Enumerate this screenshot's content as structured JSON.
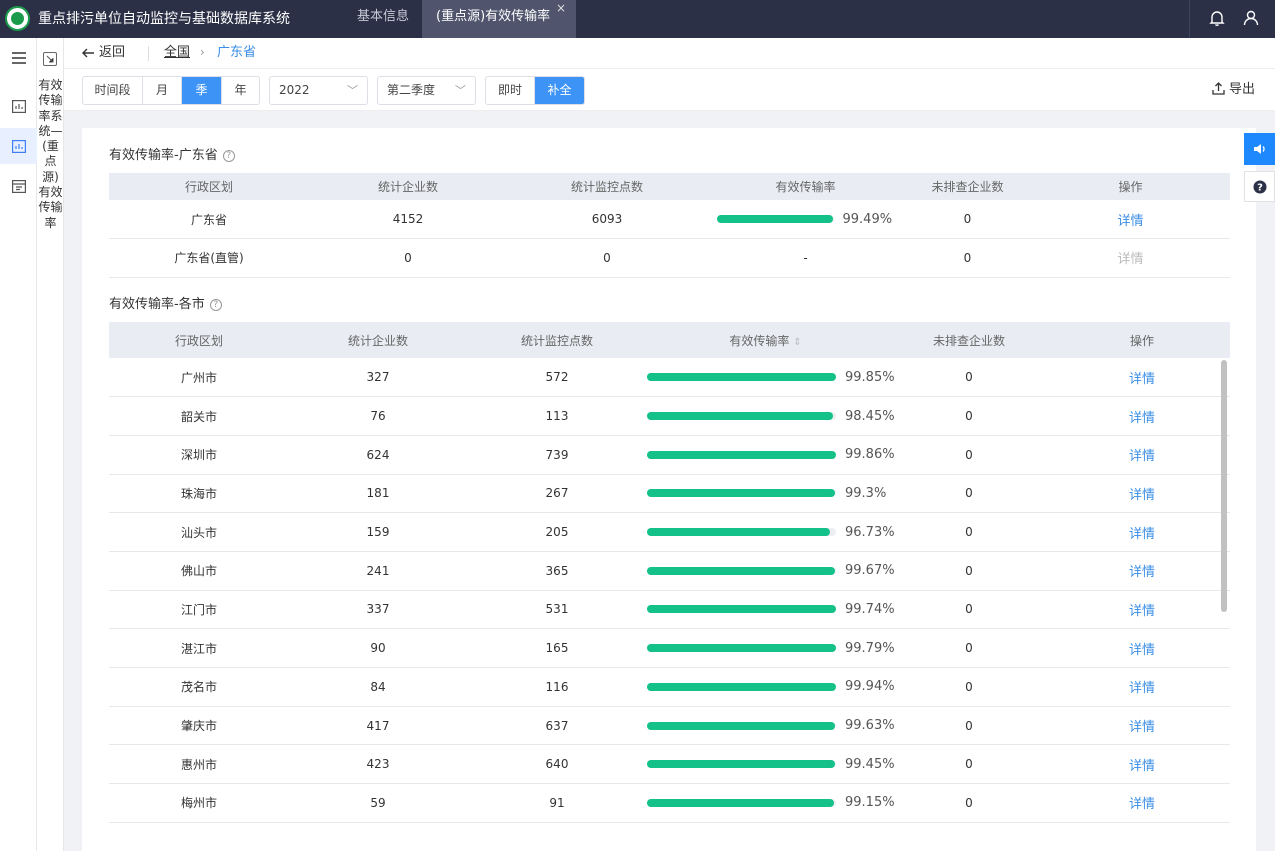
{
  "app": {
    "title": "重点排污单位自动监控与基础数据库系统"
  },
  "tabs": [
    {
      "label": "基本信息"
    },
    {
      "label": "(重点源)有效传输率",
      "close": "×"
    }
  ],
  "sidebar": {
    "vertical_label": "有效传输率系统—(重点源)有效传输率"
  },
  "breadcrumb": {
    "back": "返回",
    "root": "全国",
    "separator": "›",
    "current": "广东省"
  },
  "filters": {
    "period_buttons": [
      "时间段",
      "月",
      "季",
      "年"
    ],
    "period_selected": "季",
    "year": "2022",
    "quarter": "第二季度",
    "mode_buttons": [
      "即时",
      "补全"
    ],
    "mode_selected": "补全",
    "export": "导出"
  },
  "province_section": {
    "title": "有效传输率-广东省",
    "help": "?",
    "columns": [
      "行政区划",
      "统计企业数",
      "统计监控点数",
      "有效传输率",
      "未排查企业数",
      "操作"
    ],
    "rows": [
      {
        "region": "广东省",
        "enterprises": "4152",
        "points": "6093",
        "rate": 99.49,
        "rate_text": "99.49%",
        "unchecked": "0",
        "action": "详情",
        "enabled": true
      },
      {
        "region": "广东省(直管)",
        "enterprises": "0",
        "points": "0",
        "rate": null,
        "rate_text": "-",
        "unchecked": "0",
        "action": "详情",
        "enabled": false
      }
    ]
  },
  "city_section": {
    "title": "有效传输率-各市",
    "help": "?",
    "columns": [
      "行政区划",
      "统计企业数",
      "统计监控点数",
      "有效传输率",
      "未排查企业数",
      "操作"
    ],
    "sort_icon": "⇕",
    "rows": [
      {
        "region": "广州市",
        "enterprises": "327",
        "points": "572",
        "rate": 99.85,
        "rate_text": "99.85%",
        "unchecked": "0",
        "action": "详情"
      },
      {
        "region": "韶关市",
        "enterprises": "76",
        "points": "113",
        "rate": 98.45,
        "rate_text": "98.45%",
        "unchecked": "0",
        "action": "详情"
      },
      {
        "region": "深圳市",
        "enterprises": "624",
        "points": "739",
        "rate": 99.86,
        "rate_text": "99.86%",
        "unchecked": "0",
        "action": "详情"
      },
      {
        "region": "珠海市",
        "enterprises": "181",
        "points": "267",
        "rate": 99.3,
        "rate_text": "99.3%",
        "unchecked": "0",
        "action": "详情"
      },
      {
        "region": "汕头市",
        "enterprises": "159",
        "points": "205",
        "rate": 96.73,
        "rate_text": "96.73%",
        "unchecked": "0",
        "action": "详情"
      },
      {
        "region": "佛山市",
        "enterprises": "241",
        "points": "365",
        "rate": 99.67,
        "rate_text": "99.67%",
        "unchecked": "0",
        "action": "详情"
      },
      {
        "region": "江门市",
        "enterprises": "337",
        "points": "531",
        "rate": 99.74,
        "rate_text": "99.74%",
        "unchecked": "0",
        "action": "详情"
      },
      {
        "region": "湛江市",
        "enterprises": "90",
        "points": "165",
        "rate": 99.79,
        "rate_text": "99.79%",
        "unchecked": "0",
        "action": "详情"
      },
      {
        "region": "茂名市",
        "enterprises": "84",
        "points": "116",
        "rate": 99.94,
        "rate_text": "99.94%",
        "unchecked": "0",
        "action": "详情"
      },
      {
        "region": "肇庆市",
        "enterprises": "417",
        "points": "637",
        "rate": 99.63,
        "rate_text": "99.63%",
        "unchecked": "0",
        "action": "详情"
      },
      {
        "region": "惠州市",
        "enterprises": "423",
        "points": "640",
        "rate": 99.45,
        "rate_text": "99.45%",
        "unchecked": "0",
        "action": "详情"
      },
      {
        "region": "梅州市",
        "enterprises": "59",
        "points": "91",
        "rate": 99.15,
        "rate_text": "99.15%",
        "unchecked": "0",
        "action": "详情"
      }
    ]
  },
  "colors": {
    "header_bg": "#2c3047",
    "accent": "#3d94f6",
    "bar_fill": "#13c189",
    "link": "#3a8ee6"
  },
  "icons": [
    "logo-icon",
    "bell-icon",
    "user-icon",
    "menu-icon",
    "chart-icon",
    "monitor-chart-icon",
    "database-icon",
    "collapse-icon",
    "back-arrow-icon",
    "export-icon",
    "speaker-icon",
    "help-icon"
  ]
}
